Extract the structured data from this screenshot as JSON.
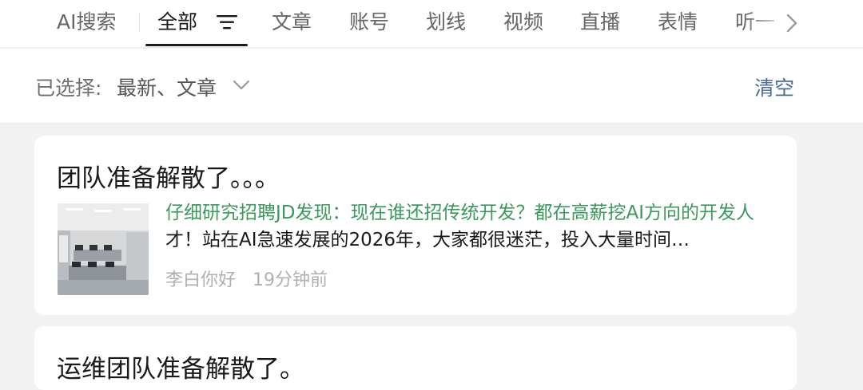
{
  "tabs": [
    {
      "label": "AI搜索"
    },
    {
      "label": "全部",
      "active": true
    },
    {
      "label": "文章"
    },
    {
      "label": "账号"
    },
    {
      "label": "划线"
    },
    {
      "label": "视频"
    },
    {
      "label": "直播"
    },
    {
      "label": "表情"
    },
    {
      "label": "听一"
    }
  ],
  "filter": {
    "prefix": "已选择:",
    "values": "最新、文章",
    "clear_label": "清空"
  },
  "results": [
    {
      "title": "团队准备解散了。。。",
      "snippet_highlight": "仔细研究招聘JD发现：现在谁还招传统开发？都在高薪挖AI方向的开发人",
      "snippet_rest": "才！站在AI急速发展的2026年，大家都很迷茫，投入大量时间…",
      "author": "李白你好",
      "time": "19分钟前"
    },
    {
      "title": "运维团队准备解散了。"
    }
  ],
  "colors": {
    "highlight": "#3a9a5c",
    "clear": "#4a6a9a"
  }
}
